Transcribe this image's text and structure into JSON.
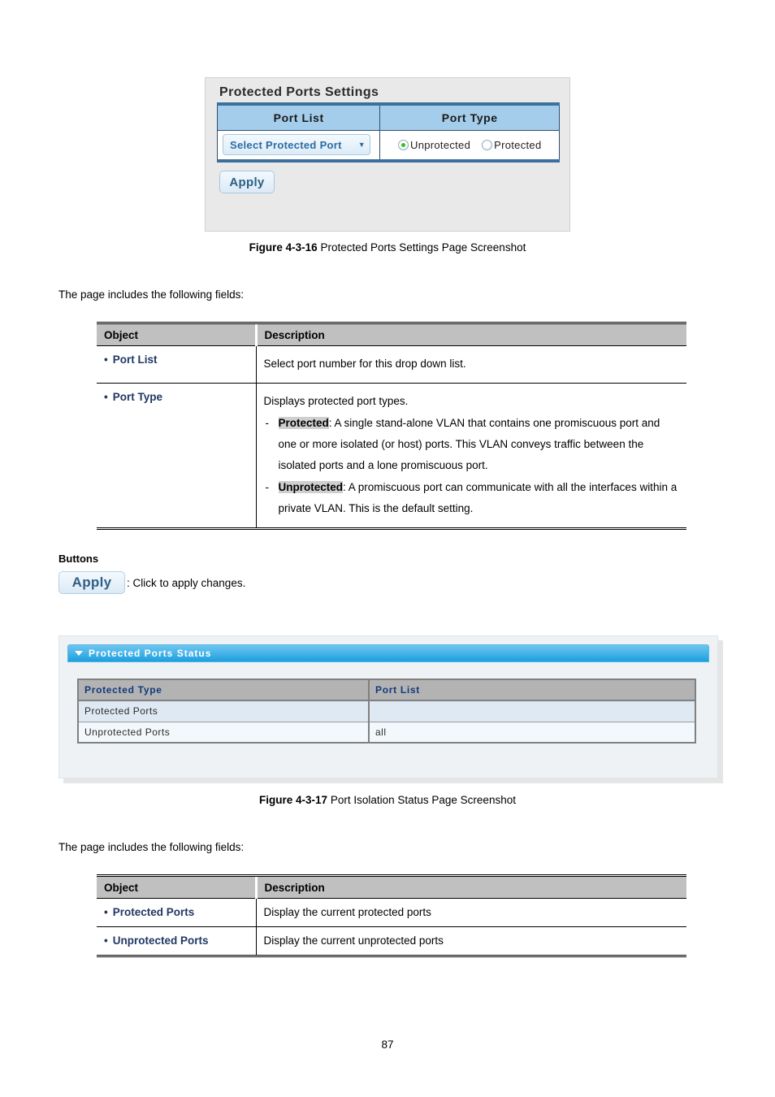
{
  "figure1": {
    "ui": {
      "panel_title": "Protected Ports Settings",
      "columns": [
        "Port List",
        "Port Type"
      ],
      "port_list_button": "Select Protected Port",
      "port_list_button_caret": "▼",
      "radios": [
        {
          "label": "Unprotected",
          "selected": true
        },
        {
          "label": "Protected",
          "selected": false
        }
      ],
      "apply_label": "Apply",
      "accent_header": "#a4cdeb",
      "accent_bar": "#3c6f9e",
      "selected_dot": "#2ec31f"
    },
    "caption_bold": "Figure 4-3-16",
    "caption_text": "Protected Ports Settings Page Screenshot"
  },
  "intro1": "The page includes the following fields:",
  "table1": {
    "headers": [
      "Object",
      "Description"
    ],
    "rows": [
      {
        "object": "Port List",
        "desc_lead": "Select port number for this drop down list.",
        "items": []
      },
      {
        "object": "Port Type",
        "desc_lead": "Displays protected port types.",
        "items": [
          {
            "term": "Protected",
            "text": ": A single stand-alone VLAN that contains one promiscuous port and one or more isolated (or host) ports. This VLAN conveys traffic between the isolated ports and a lone promiscuous port."
          },
          {
            "term": "Unprotected",
            "text": ": A promiscuous port can communicate with all the interfaces within a private VLAN. This is the default setting."
          }
        ]
      }
    ]
  },
  "buttons_section": {
    "label": "Buttons",
    "apply_label": "Apply",
    "apply_desc": ": Click to apply changes."
  },
  "figure2": {
    "panel_title": "Protected Ports Status",
    "collapse_icon": "triangle-down-icon",
    "table": {
      "headers": [
        "Protected Type",
        "Port List"
      ],
      "rows": [
        {
          "type": "Protected Ports",
          "ports": ""
        },
        {
          "type": "Unprotected Ports",
          "ports": "all"
        }
      ]
    },
    "caption_bold": "Figure 4-3-17",
    "caption_text": "Port Isolation Status Page Screenshot"
  },
  "intro2": "The page includes the following fields:",
  "table2": {
    "headers": [
      "Object",
      "Description"
    ],
    "rows": [
      {
        "object": "Protected Ports",
        "desc": "Display the current protected ports"
      },
      {
        "object": "Unprotected Ports",
        "desc": "Display the current unprotected ports"
      }
    ]
  },
  "footer": {
    "page_number": "87"
  }
}
